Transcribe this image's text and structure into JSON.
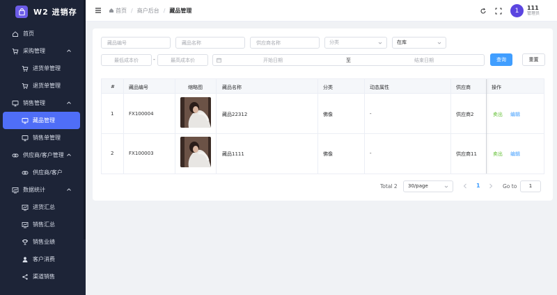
{
  "app": {
    "title": "W2 进销存",
    "logo_icon": "bag-icon"
  },
  "sidebar": {
    "items": [
      {
        "label": "首页",
        "icon": "home-icon",
        "level": 0
      },
      {
        "label": "采购管理",
        "icon": "cart-icon",
        "level": 0,
        "expanded": true
      },
      {
        "label": "进货单管理",
        "icon": "cart-icon",
        "level": 1
      },
      {
        "label": "退货单管理",
        "icon": "cart-icon",
        "level": 1
      },
      {
        "label": "销售管理",
        "icon": "monitor-icon",
        "level": 0,
        "expanded": true
      },
      {
        "label": "藏品管理",
        "icon": "monitor-icon",
        "level": 1,
        "active": true
      },
      {
        "label": "销售单管理",
        "icon": "monitor-icon",
        "level": 1
      },
      {
        "label": "供应商/客户管理",
        "icon": "chain-icon",
        "level": 0,
        "expanded": true
      },
      {
        "label": "供应商/客户",
        "icon": "chain-icon",
        "level": 1
      },
      {
        "label": "数据统计",
        "icon": "chart-icon",
        "level": 0,
        "expanded": true
      },
      {
        "label": "进货汇总",
        "icon": "chart-icon",
        "level": 1
      },
      {
        "label": "销售汇总",
        "icon": "chart-icon",
        "level": 1
      },
      {
        "label": "销售业绩",
        "icon": "trophy-icon",
        "level": 1
      },
      {
        "label": "客户消费",
        "icon": "user-icon",
        "level": 1
      },
      {
        "label": "渠道销售",
        "icon": "share-icon",
        "level": 1
      }
    ]
  },
  "header": {
    "breadcrumb": [
      "首页",
      "商户后台",
      "藏品管理"
    ],
    "user": {
      "avatar": "1",
      "name": "111",
      "role": "管理员"
    }
  },
  "filters": {
    "code_placeholder": "藏品编号",
    "name_placeholder": "藏品名称",
    "supplier_placeholder": "供应商名称",
    "category_placeholder": "分类",
    "status_value": "在库",
    "min_cost_placeholder": "最低成本价",
    "max_cost_placeholder": "最高成本价",
    "range_separator": "-",
    "start_date_placeholder": "开始日期",
    "date_separator": "至",
    "end_date_placeholder": "结束日期",
    "search_label": "查询",
    "reset_label": "重置"
  },
  "table": {
    "columns": [
      "#",
      "藏品编号",
      "缩略图",
      "藏品名称",
      "分类",
      "动态属性",
      "供应商",
      "操作"
    ],
    "rows": [
      {
        "index": "1",
        "code": "FX100004",
        "name": "藏品22312",
        "category": "佛像",
        "attrs": "-",
        "supplier": "供应商2",
        "sell": "卖出",
        "edit": "编辑"
      },
      {
        "index": "2",
        "code": "FX100003",
        "name": "藏品1111",
        "category": "佛像",
        "attrs": "-",
        "supplier": "供应商11",
        "sell": "卖出",
        "edit": "编辑"
      }
    ]
  },
  "pagination": {
    "total": "Total 2",
    "page_size": "30/page",
    "current_page": "1",
    "goto_label": "Go to",
    "goto_value": "1"
  },
  "colors": {
    "sidebar_bg": "#1d2437",
    "accent": "#4f6ef7",
    "primary": "#409eff",
    "sell": "#67c23a"
  }
}
